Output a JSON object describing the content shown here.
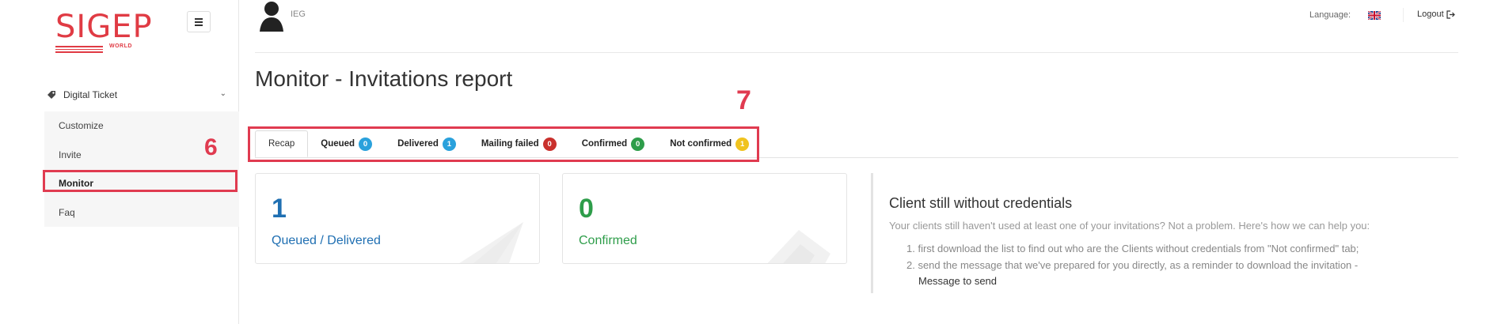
{
  "brand": {
    "logo_text": "SIGEP",
    "logo_sub": "WORLD",
    "color": "#e03b44"
  },
  "header": {
    "user": "IEG",
    "language_label": "Language:",
    "flag_icon": "uk-flag-icon",
    "logout_label": "Logout"
  },
  "sidebar": {
    "section": "Digital Ticket",
    "items": [
      {
        "label": "Customize"
      },
      {
        "label": "Invite"
      },
      {
        "label": "Monitor",
        "active": true
      },
      {
        "label": "Faq"
      }
    ]
  },
  "annotations": {
    "marker_6": "6",
    "marker_7": "7",
    "color": "#e03b50"
  },
  "page": {
    "title": "Monitor - Invitations report"
  },
  "tabs": [
    {
      "label": "Recap",
      "active": true
    },
    {
      "label": "Queued",
      "count": "0",
      "color": "#2aa1dc"
    },
    {
      "label": "Delivered",
      "count": "1",
      "color": "#2aa1dc"
    },
    {
      "label": "Mailing failed",
      "count": "0",
      "color": "#c9302c"
    },
    {
      "label": "Confirmed",
      "count": "0",
      "color": "#2e9d4a"
    },
    {
      "label": "Not confirmed",
      "count": "1",
      "color": "#f0c31f"
    }
  ],
  "cards": [
    {
      "value": "1",
      "label": "Queued / Delivered",
      "color": "#1f6fb2"
    },
    {
      "value": "0",
      "label": "Confirmed",
      "color": "#2e9d4a"
    }
  ],
  "help": {
    "title": "Client still without credentials",
    "intro": "Your clients still haven't used at least one of your invitations? Not a problem. Here's how we can help you:",
    "steps": [
      "1. first download the list to find out who are the Clients without credentials from \"Not confirmed\" tab;",
      "2. send the message that we've prepared for you directly, as a reminder to download the invitation -"
    ],
    "link": "Message to send"
  }
}
